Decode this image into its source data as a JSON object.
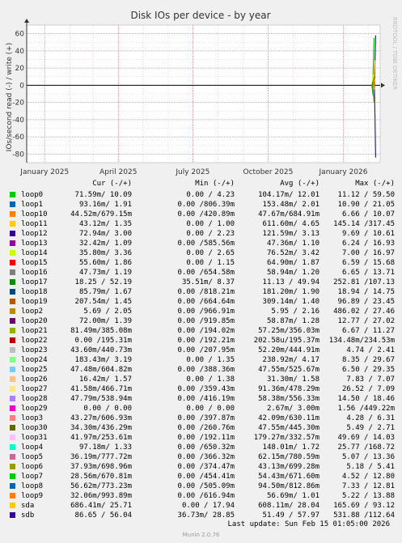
{
  "title": "Disk IOs per device - by year",
  "ylabel": "IOs/second read (-) / write (+)",
  "watermark": "RRDTOOL / TOBI OETIKER",
  "header": {
    "cur": "Cur (-/+)",
    "min": "Min (-/+)",
    "avg": "Avg (-/+)",
    "max": "Max (-/+)"
  },
  "last_update": "Last update: Sun Feb 15 01:05:00 2026",
  "footer": "Munin 2.0.76",
  "chart_data": {
    "type": "line",
    "title": "Disk IOs per device - by year",
    "ylabel": "IOs/second read (-) / write (+)",
    "xlabel": "",
    "x_ticks": [
      "January 2025",
      "April 2025",
      "July 2025",
      "October 2025",
      "January 2026"
    ],
    "x_tick_dates": [
      "2025-01-01",
      "2025-04-01",
      "2025-07-01",
      "2025-10-01",
      "2026-01-01"
    ],
    "x_range": [
      "2024-12-10",
      "2026-02-15"
    ],
    "y_ticks": [
      -80,
      -60,
      -40,
      -20,
      0,
      20,
      40,
      60
    ],
    "ylim": [
      -90,
      70
    ],
    "grid": true,
    "spikes": [
      {
        "name": "sdb",
        "date": "2026-02-08",
        "values": [
          58,
          -84
        ],
        "color": "#2a1eb0"
      },
      {
        "name": "loop0",
        "date": "2026-02-06",
        "values": [
          55,
          0
        ],
        "color": "#00cc00"
      },
      {
        "name": "loop11",
        "date": "2026-02-07",
        "values": [
          29,
          0
        ],
        "color": "#ffcc00"
      },
      {
        "name": "loop14",
        "date": "2026-02-05",
        "values": [
          12,
          0
        ],
        "color": "#ccff00"
      },
      {
        "name": "loop17",
        "date": "2026-02-05",
        "values": [
          5,
          -12
        ],
        "color": "#008f00"
      },
      {
        "name": "loop21",
        "date": "2026-02-06",
        "values": [
          10,
          -20
        ],
        "color": "#6e9a00"
      },
      {
        "name": "loop9",
        "date": "2026-02-07",
        "values": [
          8,
          -5
        ],
        "color": "#f28c00"
      }
    ]
  },
  "legend": [
    {
      "name": "loop0",
      "color": "#00cc00",
      "cur": "71.59m/ 10.09",
      "min": "0.00 / 4.23",
      "avg": "104.17m/ 12.01",
      "max": "11.12 / 59.50"
    },
    {
      "name": "loop1",
      "color": "#0066b3",
      "cur": "93.16m/ 1.91",
      "min": "0.00 /806.39m",
      "avg": "153.48m/ 2.01",
      "max": "10.90 / 21.05"
    },
    {
      "name": "loop10",
      "color": "#ff8000",
      "cur": "44.52m/679.15m",
      "min": "0.00 /420.89m",
      "avg": "47.67m/684.91m",
      "max": "6.66 / 10.07"
    },
    {
      "name": "loop11",
      "color": "#ffcc00",
      "cur": "43.12m/ 1.35",
      "min": "0.00 / 1.00",
      "avg": "611.60m/ 4.65",
      "max": "145.14 /317.45"
    },
    {
      "name": "loop12",
      "color": "#330099",
      "cur": "72.94m/ 3.00",
      "min": "0.00 / 2.23",
      "avg": "121.59m/ 3.13",
      "max": "9.69 / 10.61"
    },
    {
      "name": "loop13",
      "color": "#990099",
      "cur": "32.42m/ 1.09",
      "min": "0.00 /585.56m",
      "avg": "47.36m/ 1.10",
      "max": "6.24 / 16.93"
    },
    {
      "name": "loop14",
      "color": "#ccff00",
      "cur": "35.80m/ 3.36",
      "min": "0.00 / 2.65",
      "avg": "76.52m/ 3.42",
      "max": "7.00 / 16.97"
    },
    {
      "name": "loop15",
      "color": "#ff0000",
      "cur": "55.60m/ 1.86",
      "min": "0.00 / 1.15",
      "avg": "64.90m/ 1.87",
      "max": "6.59 / 15.68"
    },
    {
      "name": "loop16",
      "color": "#808080",
      "cur": "47.73m/ 1.19",
      "min": "0.00 /654.58m",
      "avg": "58.94m/ 1.20",
      "max": "6.65 / 13.71"
    },
    {
      "name": "loop17",
      "color": "#008f00",
      "cur": "18.25 / 52.19",
      "min": "35.51m/ 8.37",
      "avg": "11.13 / 49.94",
      "max": "252.81 /107.13"
    },
    {
      "name": "loop18",
      "color": "#00487d",
      "cur": "85.79m/ 1.67",
      "min": "0.00 /818.21m",
      "avg": "181.20m/ 1.90",
      "max": "18.94 / 14.75"
    },
    {
      "name": "loop19",
      "color": "#b35a00",
      "cur": "207.54m/ 1.45",
      "min": "0.00 /664.64m",
      "avg": "309.14m/ 1.40",
      "max": "96.89 / 23.45"
    },
    {
      "name": "loop2",
      "color": "#b38f00",
      "cur": "5.69 / 2.05",
      "min": "0.00 /966.91m",
      "avg": "5.95 / 2.16",
      "max": "486.02 / 27.46"
    },
    {
      "name": "loop20",
      "color": "#6b006b",
      "cur": "72.00m/ 1.39",
      "min": "0.00 /919.85m",
      "avg": "58.87m/ 1.28",
      "max": "12.77 / 27.02"
    },
    {
      "name": "loop21",
      "color": "#8fb300",
      "cur": "81.49m/385.08m",
      "min": "0.00 /194.02m",
      "avg": "57.25m/356.03m",
      "max": "6.67 / 11.27"
    },
    {
      "name": "loop22",
      "color": "#b30000",
      "cur": "0.00 /195.31m",
      "min": "0.00 /192.21m",
      "avg": "202.58u/195.37m",
      "max": "134.48m/234.53m"
    },
    {
      "name": "loop23",
      "color": "#bebebe",
      "cur": "43.60m/440.73m",
      "min": "0.00 /207.95m",
      "avg": "52.20m/444.91m",
      "max": "4.74 / 2.41"
    },
    {
      "name": "loop24",
      "color": "#80ff80",
      "cur": "183.43m/ 3.19",
      "min": "0.00 / 1.35",
      "avg": "238.92m/ 4.17",
      "max": "8.35 / 29.67"
    },
    {
      "name": "loop25",
      "color": "#80c9ff",
      "cur": "47.48m/604.82m",
      "min": "0.00 /388.36m",
      "avg": "47.55m/525.67m",
      "max": "6.50 / 29.35"
    },
    {
      "name": "loop26",
      "color": "#ffc080",
      "cur": "16.42m/ 1.57",
      "min": "0.00 / 1.38",
      "avg": "31.30m/ 1.58",
      "max": "7.83 / 7.07"
    },
    {
      "name": "loop27",
      "color": "#ffe680",
      "cur": "41.58m/466.71m",
      "min": "0.00 /359.43m",
      "avg": "91.36m/478.29m",
      "max": "26.52 / 7.09"
    },
    {
      "name": "loop28",
      "color": "#aa80ff",
      "cur": "47.79m/538.94m",
      "min": "0.00 /416.19m",
      "avg": "58.38m/556.33m",
      "max": "14.50 / 18.46"
    },
    {
      "name": "loop29",
      "color": "#ee00cc",
      "cur": "0.00 / 0.00",
      "min": "0.00 / 0.00",
      "avg": "2.67m/ 3.00m",
      "max": "1.56 /449.22m"
    },
    {
      "name": "loop3",
      "color": "#ff8080",
      "cur": "43.27m/606.93m",
      "min": "0.00 /397.87m",
      "avg": "42.09m/630.11m",
      "max": "4.28 / 6.31"
    },
    {
      "name": "loop30",
      "color": "#666600",
      "cur": "34.30m/436.29m",
      "min": "0.00 /260.76m",
      "avg": "47.55m/445.30m",
      "max": "5.49 / 2.71"
    },
    {
      "name": "loop31",
      "color": "#ffbfff",
      "cur": "41.97m/253.61m",
      "min": "0.00 /192.11m",
      "avg": "179.27m/332.57m",
      "max": "49.69 / 14.03"
    },
    {
      "name": "loop4",
      "color": "#00ffcc",
      "cur": "97.18m/ 1.33",
      "min": "0.00 /650.32m",
      "avg": "148.01m/ 1.72",
      "max": "25.77 /168.72"
    },
    {
      "name": "loop5",
      "color": "#cc6699",
      "cur": "36.19m/777.72m",
      "min": "0.00 /366.32m",
      "avg": "62.15m/780.59m",
      "max": "5.07 / 13.36"
    },
    {
      "name": "loop6",
      "color": "#999900",
      "cur": "37.93m/698.96m",
      "min": "0.00 /374.47m",
      "avg": "43.13m/699.28m",
      "max": "5.18 / 5.41"
    },
    {
      "name": "loop7",
      "color": "#00cc00",
      "cur": "28.56m/670.81m",
      "min": "0.00 /454.41m",
      "avg": "54.43m/671.60m",
      "max": "4.52 / 12.80"
    },
    {
      "name": "loop8",
      "color": "#0066b3",
      "cur": "56.62m/773.23m",
      "min": "0.00 /505.09m",
      "avg": "94.50m/812.86m",
      "max": "7.33 / 12.81"
    },
    {
      "name": "loop9",
      "color": "#ff8000",
      "cur": "32.06m/993.89m",
      "min": "0.00 /616.94m",
      "avg": "56.69m/ 1.01",
      "max": "5.22 / 13.88"
    },
    {
      "name": "sda",
      "color": "#ffcc00",
      "cur": "686.41m/ 25.71",
      "min": "0.00 / 17.94",
      "avg": "608.11m/ 28.04",
      "max": "165.69 / 93.12"
    },
    {
      "name": "sdb",
      "color": "#330099",
      "cur": "86.65 / 56.04",
      "min": "36.73m/ 28.85",
      "avg": "51.49 / 57.97",
      "max": "531.88 /112.64"
    }
  ]
}
